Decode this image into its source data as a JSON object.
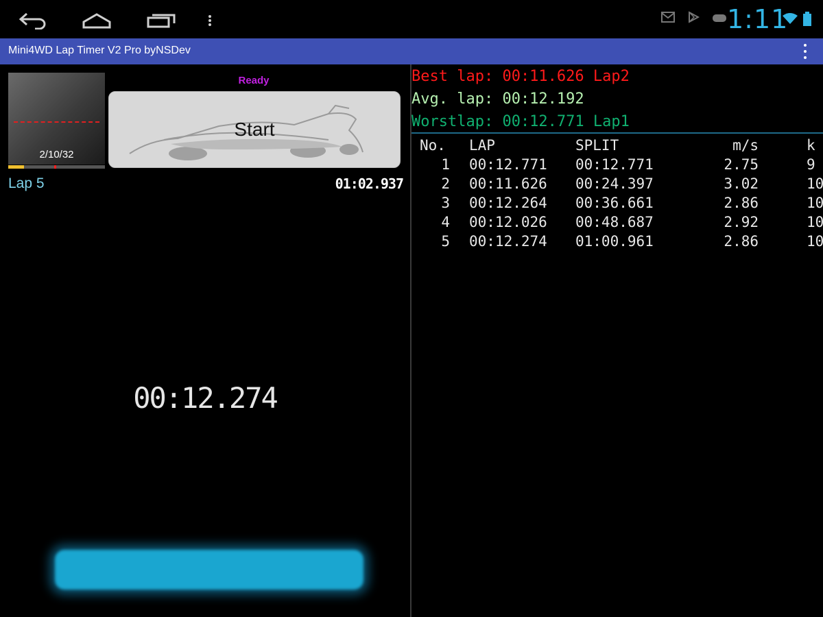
{
  "system": {
    "clock": "1:11"
  },
  "icons": {
    "back": "back-arrow-icon",
    "home": "home-icon",
    "recents": "recent-apps-icon",
    "menu": "menu-dots-icon",
    "status": [
      "gmail-icon",
      "play-store-icon",
      "game-controller-icon"
    ],
    "wifi": "wifi-icon",
    "battery": "battery-icon",
    "overflow": "overflow-menu-icon"
  },
  "colors": {
    "actionbar": "#3e50b4",
    "clock": "#33b5e5",
    "best": "#ff1a1a",
    "avg": "#b6f0b0",
    "worst": "#10b070",
    "ready": "#c020e0",
    "lap_label": "#7fd3ea"
  },
  "actionbar": {
    "title": "Mini4WD Lap Timer V2 Pro byNSDev"
  },
  "left": {
    "thumbnail_count": "2/10/32",
    "status": "Ready",
    "start_label": "Start",
    "lap_label": "Lap 5",
    "total_time": "01:02.937",
    "current_time": "00:12.274",
    "thumbnail_progress": 0.16
  },
  "stats": {
    "best": "Best lap: 00:11.626 Lap2",
    "avg": "Avg. lap: 00:12.192",
    "worst": "Worstlap: 00:12.771 Lap1"
  },
  "table": {
    "headers": [
      "No.",
      "LAP",
      "SPLIT",
      "m/s",
      "k"
    ],
    "rows": [
      {
        "no": "1",
        "lap": "00:12.771",
        "split": "00:12.771",
        "ms": "2.75",
        "ext": "9"
      },
      {
        "no": "2",
        "lap": "00:11.626",
        "split": "00:24.397",
        "ms": "3.02",
        "ext": "10"
      },
      {
        "no": "3",
        "lap": "00:12.264",
        "split": "00:36.661",
        "ms": "2.86",
        "ext": "10"
      },
      {
        "no": "4",
        "lap": "00:12.026",
        "split": "00:48.687",
        "ms": "2.92",
        "ext": "10"
      },
      {
        "no": "5",
        "lap": "00:12.274",
        "split": "01:00.961",
        "ms": "2.86",
        "ext": "10"
      }
    ]
  }
}
